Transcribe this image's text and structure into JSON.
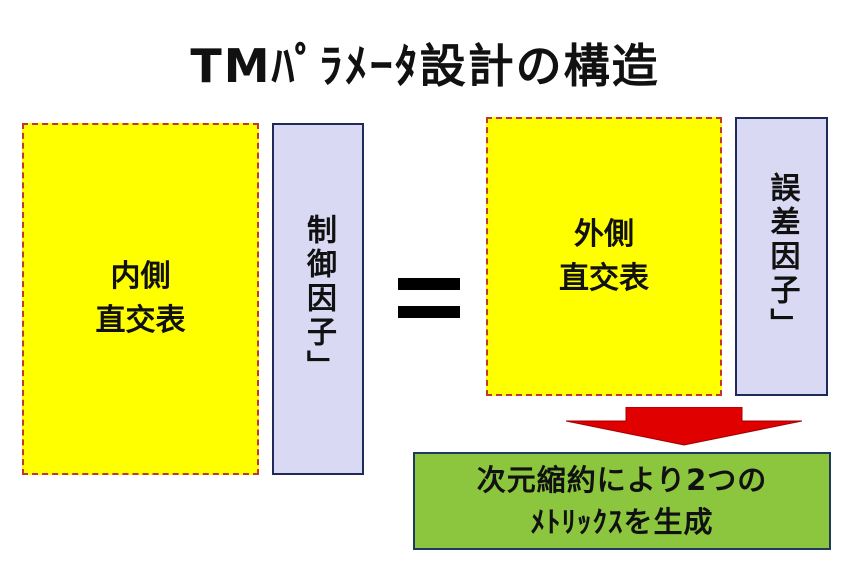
{
  "title": "TMﾊﾟﾗﾒｰﾀ設計の構造",
  "inner_array": {
    "label": "内側\n直交表"
  },
  "control_factors": {
    "label": "制御因子」"
  },
  "equals_sign": "=",
  "outer_array": {
    "label": "外側\n直交表"
  },
  "error_factors": {
    "label": "誤差因子」"
  },
  "result": {
    "line1": "次元縮約により2つの",
    "line2": "ﾒﾄﾘｯｸｽを生成"
  },
  "colors": {
    "array_fill": "#ffff00",
    "array_border": "#c0392b",
    "factor_fill": "#d9d9f3",
    "factor_border": "#1f2a5a",
    "arrow": "#e00000",
    "result_fill": "#8cc63f"
  }
}
